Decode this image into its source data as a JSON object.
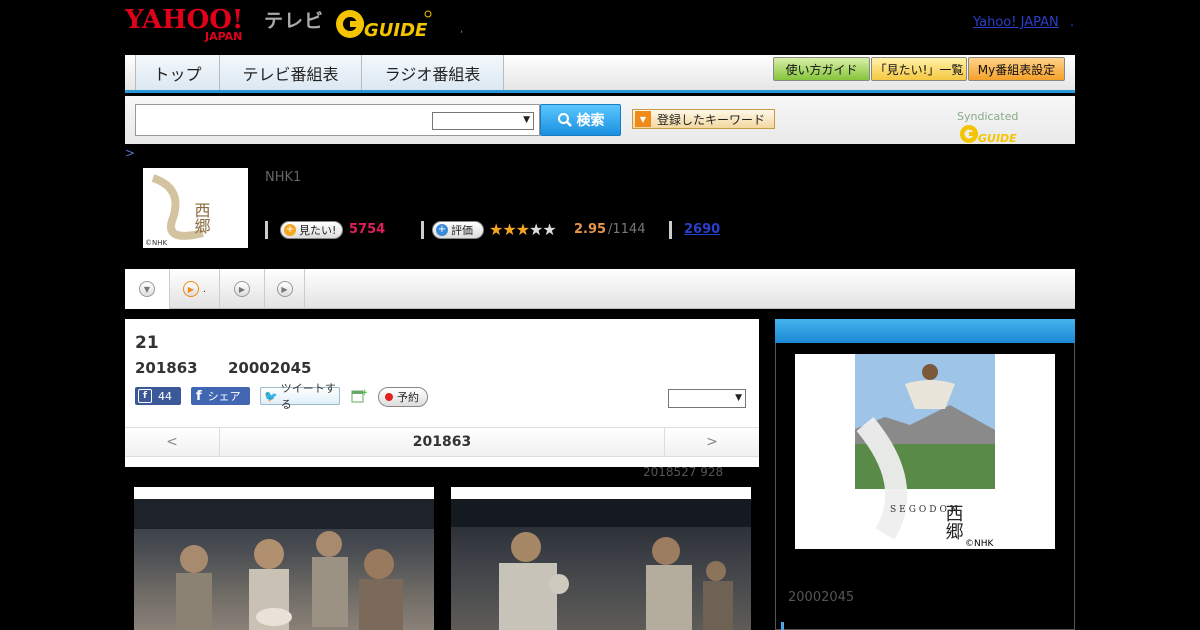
{
  "header": {
    "logo_yahoo_top": "YAHOO!",
    "logo_yahoo_bottom": "JAPAN",
    "logo_tv": "テレビ",
    "logo_gguide": "GUIDE",
    "yahoo_japan_link": "Yahoo! JAPAN",
    "link_dot": ".",
    "header_dot": ","
  },
  "nav": {
    "tabs": [
      {
        "label": "トップ"
      },
      {
        "label": "テレビ番組表"
      },
      {
        "label": "ラジオ番組表"
      }
    ],
    "buttons": [
      {
        "label": "使い方ガイド"
      },
      {
        "label": "「見たい!」一覧"
      },
      {
        "label": "My番組表設定"
      }
    ]
  },
  "search": {
    "button_label": "検索",
    "keyword_label": "登録したキーワード",
    "syndicated": "Syndicated"
  },
  "program": {
    "crumb": ">",
    "channel": "NHK1",
    "thumb_text": "西郷",
    "thumb_copyright": "©NHK",
    "mitai_label": "見たい!",
    "mitai_count": "5754",
    "rating_label": "評価",
    "rating_score": "2.95",
    "rating_total": "/1144",
    "review_count": "2690"
  },
  "subtabs": {
    "second_dot": "."
  },
  "episode": {
    "number": "21",
    "date": "201863",
    "time": "20002045",
    "like_count": "44",
    "share_label": "シェア",
    "tweet_label": "ツイートする",
    "reserve_label": "予約",
    "pager_prev": "<",
    "pager_current": "201863",
    "pager_next": ">"
  },
  "updated": "2018527  928",
  "sidebar": {
    "poster_title": "西郷",
    "poster_sub": "SEGODON",
    "poster_copyright": "©NHK",
    "time": "20002045"
  },
  "colors": {
    "accent_blue": "#2a98d8",
    "mitai_pink": "#e0205a",
    "star_gold": "#f5a623"
  }
}
